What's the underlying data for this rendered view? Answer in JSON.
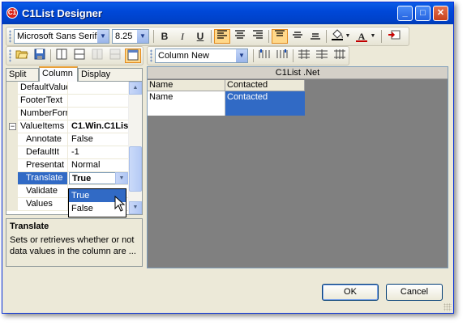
{
  "window": {
    "title": "C1List Designer",
    "minimize": "_",
    "maximize": "□",
    "close": "✕"
  },
  "toolbar1": {
    "font_name": "Microsoft Sans Serif",
    "font_size": "8.25",
    "bold": "B",
    "italic": "I",
    "underline": "U",
    "font_color_glyph": "A"
  },
  "toolbar2": {
    "column_select": "Column New"
  },
  "tabs": [
    "Split",
    "Column",
    "Display Column"
  ],
  "props": [
    {
      "name": "DefaultValue",
      "value": ""
    },
    {
      "name": "FooterText",
      "value": ""
    },
    {
      "name": "NumberForm",
      "value": ""
    },
    {
      "name": "ValueItems",
      "value": "C1.Win.C1Lis"
    },
    {
      "name": "Annotate",
      "value": "False"
    },
    {
      "name": "DefaultIt",
      "value": "-1"
    },
    {
      "name": "Presentat",
      "value": "Normal"
    },
    {
      "name": "Translate",
      "value": "True"
    },
    {
      "name": "Validate",
      "value": ""
    },
    {
      "name": "Values",
      "value": ""
    }
  ],
  "expand_glyph": "−",
  "dropdown_options": [
    "True",
    "False"
  ],
  "description": {
    "title": "Translate",
    "text": "Sets or retrieves whether or not data values in the column are ..."
  },
  "designer": {
    "caption": "C1List .Net",
    "columns": [
      "Name",
      "Contacted"
    ],
    "row": [
      "Name",
      "Contacted"
    ]
  },
  "buttons": {
    "ok": "OK",
    "cancel": "Cancel"
  },
  "colors": {
    "selection": "#316ac5",
    "titlebar": "#0054e3",
    "active_button": "#ffd88a"
  }
}
